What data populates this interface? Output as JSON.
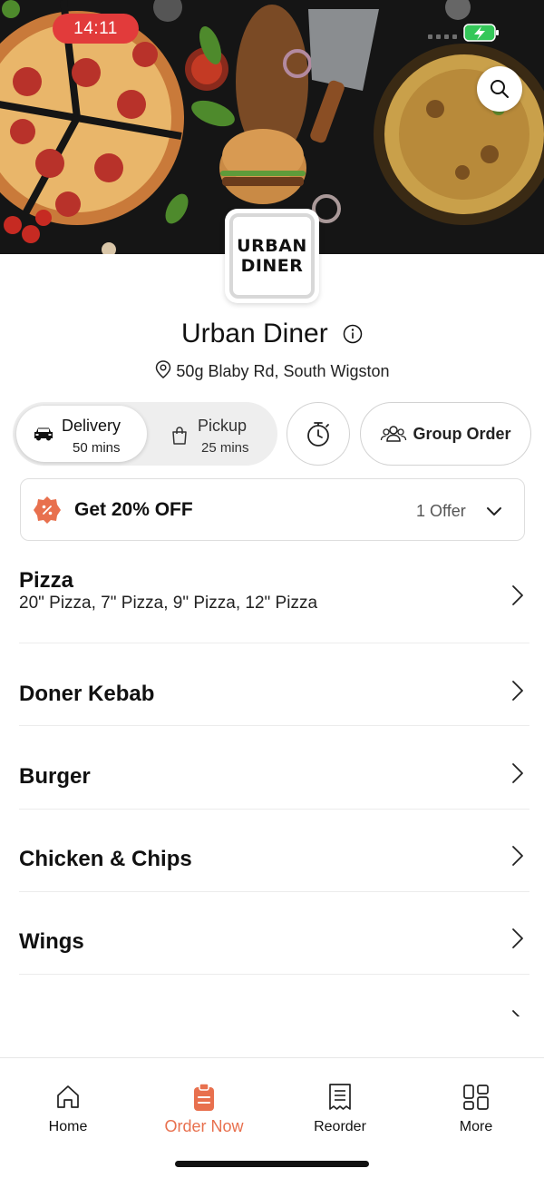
{
  "status_bar": {
    "time": "14:11"
  },
  "restaurant": {
    "logo_line1": "URBAN",
    "logo_line2": "DINER",
    "name": "Urban Diner",
    "address": "50g Blaby Rd, South Wigston"
  },
  "modes": {
    "delivery": {
      "label": "Delivery",
      "time": "50 mins",
      "selected": true
    },
    "pickup": {
      "label": "Pickup",
      "time": "25 mins",
      "selected": false
    },
    "group_order_label": "Group Order"
  },
  "offer": {
    "title": "Get 20% OFF",
    "count": "1 Offer"
  },
  "menu": {
    "items": [
      {
        "label": "Pizza",
        "subtitle": "20\" Pizza, 7\" Pizza, 9\" Pizza, 12\" Pizza"
      },
      {
        "label": "Doner Kebab"
      },
      {
        "label": "Burger"
      },
      {
        "label": "Chicken & Chips"
      },
      {
        "label": "Wings"
      }
    ]
  },
  "nav": {
    "items": [
      {
        "label": "Home",
        "icon": "home-icon",
        "active": false
      },
      {
        "label": "Order Now",
        "icon": "order-icon",
        "active": true
      },
      {
        "label": "Reorder",
        "icon": "receipt-icon",
        "active": false
      },
      {
        "label": "More",
        "icon": "grid-icon",
        "active": false
      }
    ]
  },
  "colors": {
    "accent": "#e8704e",
    "time_pill": "#e23b3b",
    "battery": "#34c759"
  }
}
